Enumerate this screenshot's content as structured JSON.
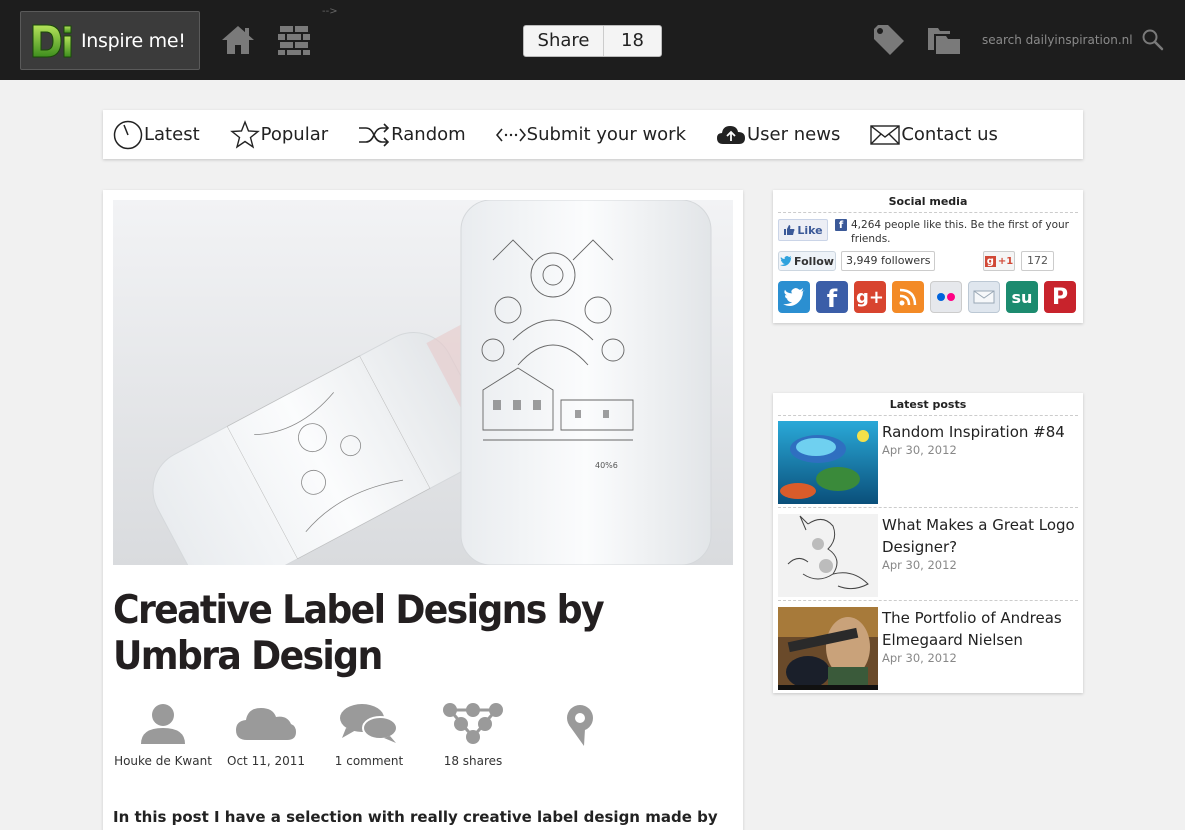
{
  "header": {
    "logo_text": "Inspire me!",
    "logo_letters": "Di",
    "share_label": "Share",
    "share_count": "18",
    "search_placeholder": "search dailyinspiration.nl",
    "stray_text": "-->"
  },
  "nav": {
    "items": [
      {
        "label": "Latest",
        "icon": "clock-icon"
      },
      {
        "label": "Popular",
        "icon": "star-icon"
      },
      {
        "label": "Random",
        "icon": "shuffle-icon"
      },
      {
        "label": "Submit your work",
        "icon": "code-arrows-icon"
      },
      {
        "label": "User news",
        "icon": "cloud-upload-icon"
      },
      {
        "label": "Contact us",
        "icon": "envelope-icon"
      }
    ]
  },
  "post": {
    "title": "Creative Label Designs by Umbra Design",
    "author": "Houke de Kwant",
    "date": "Oct 11, 2011",
    "comments": "1 comment",
    "shares": "18 shares",
    "intro": "In this post I have a selection with really creative label design made by",
    "hero_label_text": "40%6"
  },
  "sidebar": {
    "social": {
      "heading": "Social media",
      "fb_like_label": "Like",
      "fb_text": "4,264 people like this. Be the first of your friends.",
      "tw_follow_label": "Follow",
      "tw_followers": "3,949 followers",
      "gplus_label": "+1",
      "gplus_count": "172",
      "icons": [
        "twitter-icon",
        "facebook-icon",
        "google-plus-icon",
        "rss-icon",
        "flickr-icon",
        "email-icon",
        "stumbleupon-icon",
        "pinterest-icon"
      ]
    },
    "latest": {
      "heading": "Latest posts",
      "posts": [
        {
          "title": "Random Inspiration #84",
          "date": "Apr 30, 2012"
        },
        {
          "title": "What Makes a Great Logo Designer?",
          "date": "Apr 30, 2012"
        },
        {
          "title": "The Portfolio of Andreas Elmegaard Nielsen",
          "date": "Apr 30, 2012"
        }
      ]
    }
  },
  "colors": {
    "topbar": "#1d1d1d",
    "logo_green": "#7ac143",
    "page_bg": "#f1f1f1",
    "meta_icon": "#9a9a9a"
  }
}
